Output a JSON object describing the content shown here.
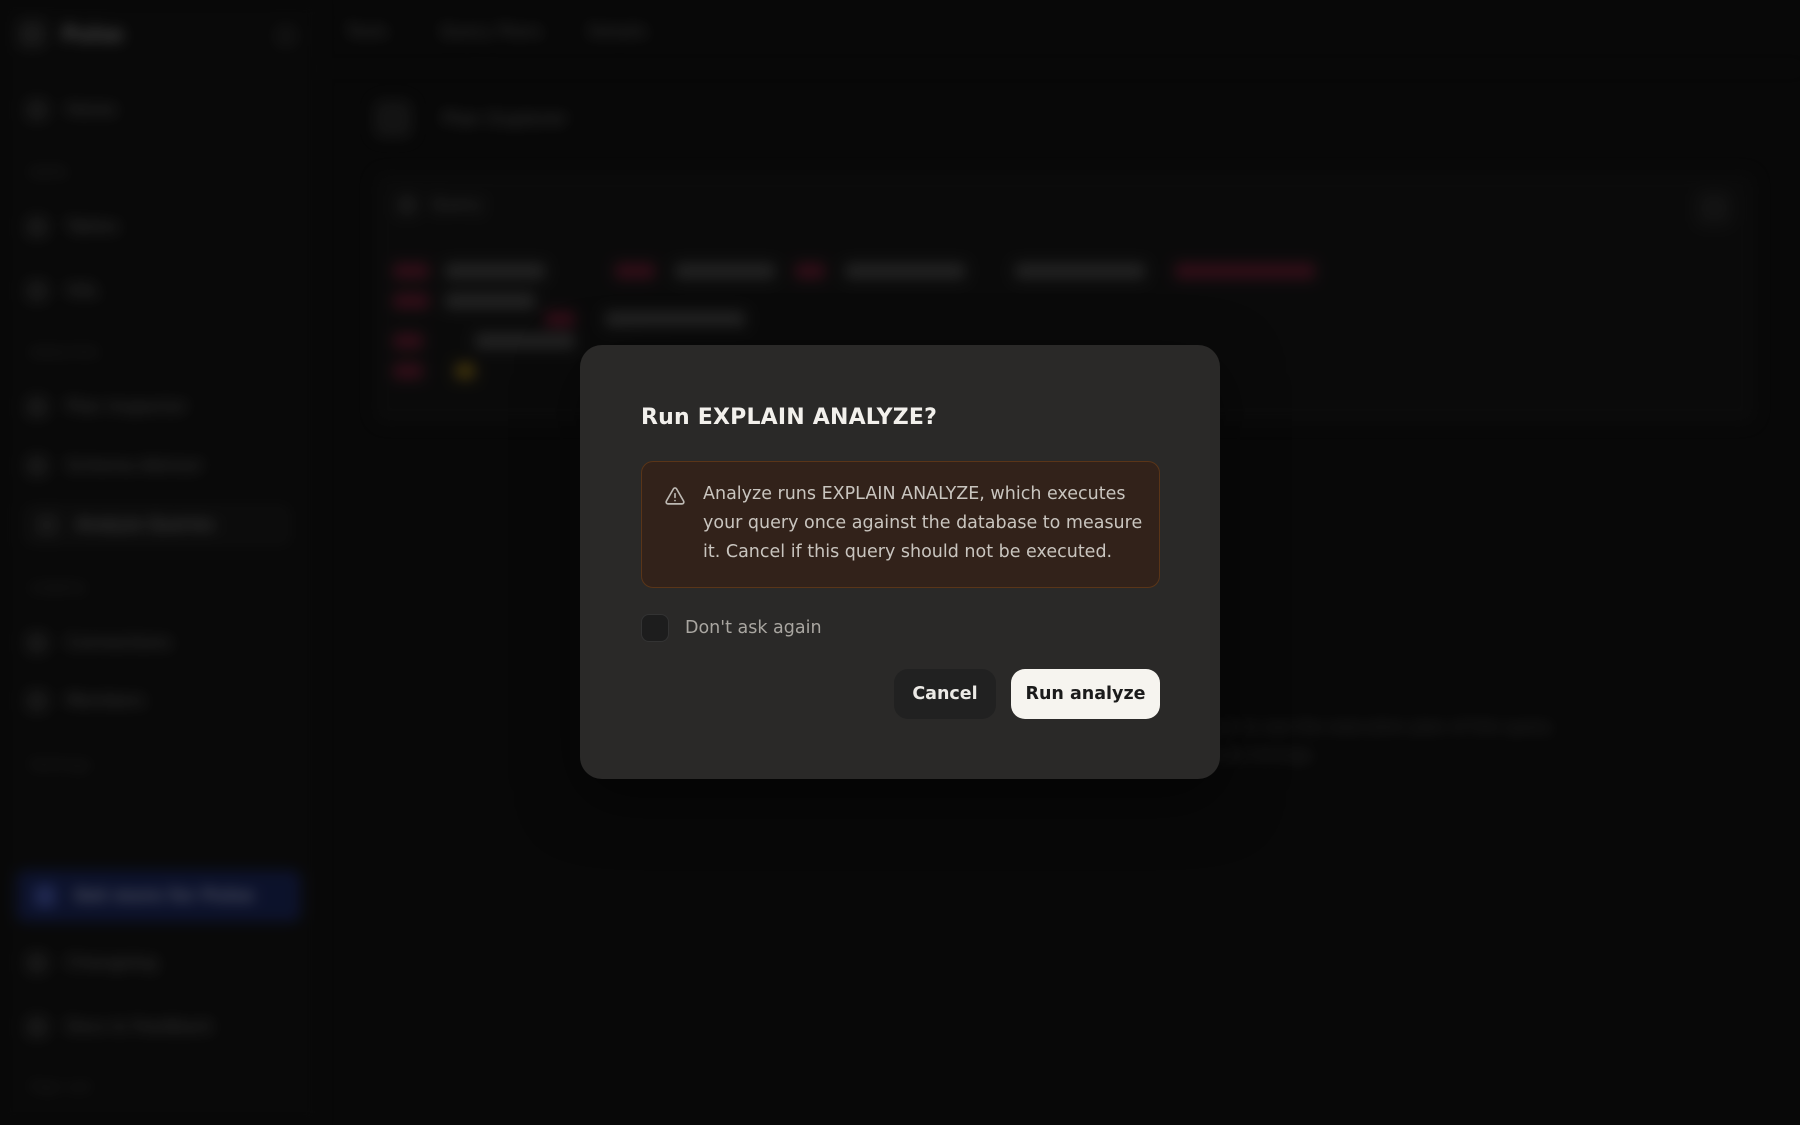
{
  "background": {
    "brand": "Pulse",
    "breadcrumbs": [
      "Tools",
      "Query Plans",
      "Details"
    ],
    "page_title": "Plan Explorer",
    "sidebar": {
      "top_item": "Home",
      "sections": [
        {
          "label": "DATA",
          "items": [
            "Tables",
            "SQL"
          ]
        },
        {
          "label": "ANALYSIS",
          "items": [
            "Plan Inspector",
            "Schema Advisor",
            "Analyze Queries"
          ]
        },
        {
          "label": "CONFIG",
          "items": [
            "Connections",
            "Members"
          ]
        }
      ],
      "extra_label": "Settings",
      "cta": "Get more for Pulse",
      "bottom_items": [
        "Changelog",
        "Docs & Feedback"
      ],
      "footer": "Sign out"
    },
    "query_card": {
      "label": "Query"
    },
    "helper_lines": [
      "Run analyze to see the execution plan of this query",
      "and per-node timings."
    ]
  },
  "dialog": {
    "title": "Run EXPLAIN ANALYZE?",
    "warning_icon": "alert-triangle-icon",
    "warning_text": "Analyze runs EXPLAIN ANALYZE, which executes your query once against the database to measure it. Cancel if this query should not be executed.",
    "checkbox_label": "Don't ask again",
    "checkbox_checked": false,
    "cancel_label": "Cancel",
    "confirm_label": "Run analyze"
  },
  "colors": {
    "modal_bg": "#2a2928",
    "warning_bg": "#32221a",
    "warning_border": "#5a3518",
    "confirm_bg": "#f6f4ef"
  }
}
